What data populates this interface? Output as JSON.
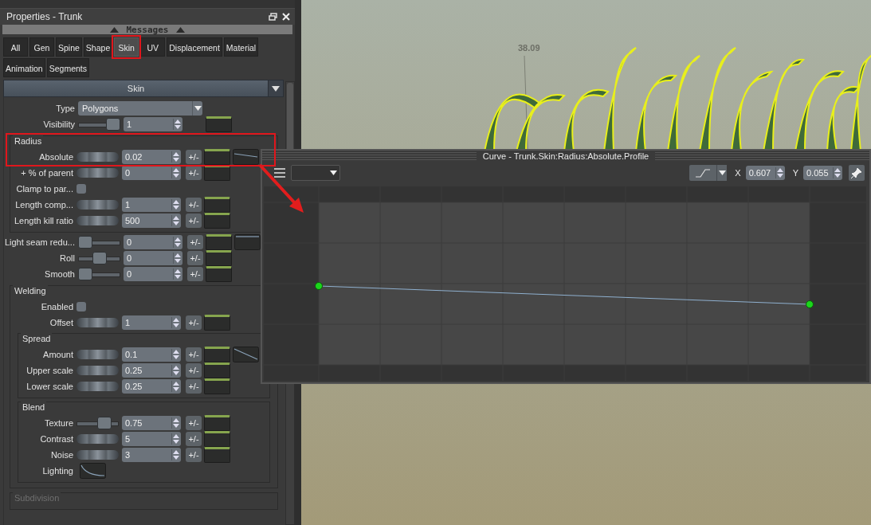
{
  "panel": {
    "title": "Properties - Trunk",
    "messages": "Messages",
    "tabs": [
      {
        "label": "All",
        "selected": false,
        "highlighted": false
      },
      {
        "label": "Gen",
        "selected": false,
        "highlighted": false
      },
      {
        "label": "Spine",
        "selected": false,
        "highlighted": false
      },
      {
        "label": "Shape",
        "selected": false,
        "highlighted": false
      },
      {
        "label": "Skin",
        "selected": true,
        "highlighted": true
      },
      {
        "label": "UV",
        "selected": false,
        "highlighted": false
      },
      {
        "label": "Displacement",
        "selected": false,
        "highlighted": false
      },
      {
        "label": "Material",
        "selected": false,
        "highlighted": false
      },
      {
        "label": "Animation",
        "selected": false,
        "highlighted": false
      },
      {
        "label": "Segments",
        "selected": false,
        "highlighted": false
      }
    ],
    "section": "Skin",
    "items": [
      {
        "kind": "select",
        "label": "Type",
        "value": "Polygons"
      },
      {
        "kind": "slider",
        "label": "Visibility",
        "level": 1,
        "value": "1"
      },
      {
        "kind": "group",
        "title": "Radius",
        "disabled": false,
        "highlighted": true,
        "children": [
          {
            "kind": "jog",
            "label": "Absolute",
            "value": "0.02",
            "plus_minus": "+/-",
            "profile": {
              "kind": "slight"
            },
            "highlighted": true
          },
          {
            "kind": "jog",
            "label": "+ % of parent",
            "value": "0",
            "plus_minus": "+/-"
          },
          {
            "kind": "check",
            "label": "Clamp to par...",
            "checked": false
          },
          {
            "kind": "jog",
            "label": "Length comp...",
            "value": "1",
            "plus_minus": "+/-"
          },
          {
            "kind": "jog",
            "label": "Length kill ratio",
            "value": "500",
            "plus_minus": "+/-"
          }
        ]
      },
      {
        "kind": "slider",
        "label": "Light seam redu...",
        "level": 0,
        "value": "0",
        "plus_minus": "+/-",
        "profile": {
          "kind": "flat"
        }
      },
      {
        "kind": "slider",
        "label": "Roll",
        "level": 0.5,
        "value": "0",
        "plus_minus": "+/-"
      },
      {
        "kind": "slider",
        "label": "Smooth",
        "level": 0,
        "value": "0",
        "plus_minus": "+/-"
      },
      {
        "kind": "group",
        "title": "Welding",
        "disabled": false,
        "children": [
          {
            "kind": "check",
            "label": "Enabled",
            "checked": false
          },
          {
            "kind": "jog",
            "label": "Offset",
            "value": "1",
            "plus_minus": "+/-"
          },
          {
            "kind": "group",
            "title": "Spread",
            "disabled": false,
            "children": [
              {
                "kind": "jog",
                "label": "Amount",
                "value": "0.1",
                "plus_minus": "+/-",
                "profile": {
                  "kind": "falling"
                }
              },
              {
                "kind": "jog",
                "label": "Upper scale",
                "value": "0.25",
                "plus_minus": "+/-"
              },
              {
                "kind": "jog",
                "label": "Lower scale",
                "value": "0.25",
                "plus_minus": "+/-"
              }
            ]
          },
          {
            "kind": "group",
            "title": "Blend",
            "disabled": false,
            "children": [
              {
                "kind": "slider",
                "label": "Texture",
                "level": 0.75,
                "value": "0.75",
                "plus_minus": "+/-"
              },
              {
                "kind": "jog",
                "label": "Contrast",
                "value": "5",
                "plus_minus": "+/-"
              },
              {
                "kind": "jog",
                "label": "Noise",
                "value": "3",
                "plus_minus": "+/-"
              },
              {
                "kind": "curve",
                "label": "Lighting",
                "profile": {
                  "kind": "ease"
                }
              }
            ]
          }
        ]
      },
      {
        "kind": "group",
        "title": "Subdivision",
        "disabled": true
      }
    ]
  },
  "viewport": {
    "measure_label": "38.09"
  },
  "curve_window": {
    "title": "Curve - Trunk.Skin:Radius:Absolute.Profile",
    "x_label": "X",
    "x_value": "0.607",
    "y_label": "Y",
    "y_value": "0.055"
  }
}
